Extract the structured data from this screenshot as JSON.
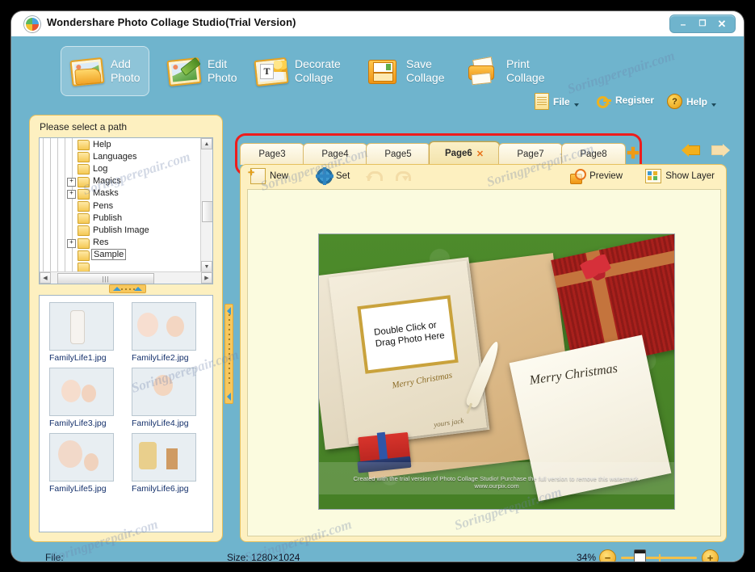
{
  "window": {
    "title": "Wondershare Photo Collage Studio(Trial Version)",
    "logo_icon": "palette-icon",
    "controls": {
      "minimize": "–",
      "maximize": "❐",
      "close": "✕"
    }
  },
  "toolbar": {
    "buttons": [
      {
        "line1": "Add",
        "line2": "Photo",
        "icon": "add-photo-icon",
        "selected": true
      },
      {
        "line1": "Edit",
        "line2": "Photo",
        "icon": "edit-photo-icon",
        "selected": false
      },
      {
        "line1": "Decorate",
        "line2": "Collage",
        "icon": "decorate-collage-icon",
        "selected": false
      },
      {
        "line1": "Save",
        "line2": "Collage",
        "icon": "save-collage-icon",
        "selected": false
      },
      {
        "line1": "Print",
        "line2": "Collage",
        "icon": "print-collage-icon",
        "selected": false
      }
    ],
    "menu": [
      {
        "label": "File",
        "icon": "file-icon",
        "caret": true
      },
      {
        "label": "Register",
        "icon": "key-icon",
        "caret": false
      },
      {
        "label": "Help",
        "icon": "question-icon",
        "caret": true
      }
    ]
  },
  "left_panel": {
    "title": "Please select a path",
    "tree": [
      {
        "name": "Help",
        "expandable": false,
        "selected": false
      },
      {
        "name": "Languages",
        "expandable": false,
        "selected": false
      },
      {
        "name": "Log",
        "expandable": false,
        "selected": false
      },
      {
        "name": "Magics",
        "expandable": true,
        "selected": false
      },
      {
        "name": "Masks",
        "expandable": true,
        "selected": false
      },
      {
        "name": "Pens",
        "expandable": false,
        "selected": false
      },
      {
        "name": "Publish",
        "expandable": false,
        "selected": false
      },
      {
        "name": "Publish Image",
        "expandable": false,
        "selected": false
      },
      {
        "name": "Res",
        "expandable": true,
        "selected": false
      },
      {
        "name": "Sample",
        "expandable": false,
        "selected": true
      }
    ],
    "thumbnails": [
      {
        "caption": "FamilyLife1.jpg"
      },
      {
        "caption": "FamilyLife2.jpg"
      },
      {
        "caption": "FamilyLife3.jpg"
      },
      {
        "caption": "FamilyLife4.jpg"
      },
      {
        "caption": "FamilyLife5.jpg"
      },
      {
        "caption": "FamilyLife6.jpg"
      }
    ]
  },
  "tabs": {
    "items": [
      {
        "label": "Page3",
        "active": false
      },
      {
        "label": "Page4",
        "active": false
      },
      {
        "label": "Page5",
        "active": false
      },
      {
        "label": "Page6",
        "active": true
      },
      {
        "label": "Page7",
        "active": false
      },
      {
        "label": "Page8",
        "active": false
      }
    ],
    "close_glyph": "✕",
    "add_glyph": "✚",
    "prev_arrow": "left-arrow-icon",
    "next_arrow": "right-arrow-icon"
  },
  "subtoolbar": {
    "items": [
      {
        "label": "New",
        "icon": "new-page-icon"
      },
      {
        "label": "Set",
        "icon": "settings-icon"
      },
      {
        "label": "",
        "icon": "undo-icon"
      },
      {
        "label": "",
        "icon": "redo-icon"
      },
      {
        "label": "Preview",
        "icon": "preview-icon"
      },
      {
        "label": "Show Layer",
        "icon": "show-layer-icon"
      }
    ]
  },
  "canvas": {
    "photo_slot_text": "Double Click or\nDrag Photo Here",
    "photo_slot_line1": "Double Click or",
    "photo_slot_line2": "Drag Photo Here",
    "book_text": "Merry Christmas",
    "book_signature": "yours jack",
    "card_text": "Merry Christmas",
    "watermark_line1": "Created with the trial version of Photo Collage Studio!  Purchase the full version to remove this watermark.",
    "watermark_line2": "www.ourpix.com"
  },
  "status": {
    "file_label": "File:",
    "size_label": "Size:  1280×1024",
    "zoom_percent": "34%",
    "zoom_out": "−",
    "zoom_in": "+"
  },
  "page_watermark": "Soringperepair.com",
  "colors": {
    "window_blue": "#6fb4cd",
    "panel_cream": "#fdf0c0",
    "panel_border": "#e6c05e",
    "accent_gold": "#f2b01d",
    "highlight_red": "#ee1c1c",
    "canvas_bg": "#fbfbdf"
  }
}
